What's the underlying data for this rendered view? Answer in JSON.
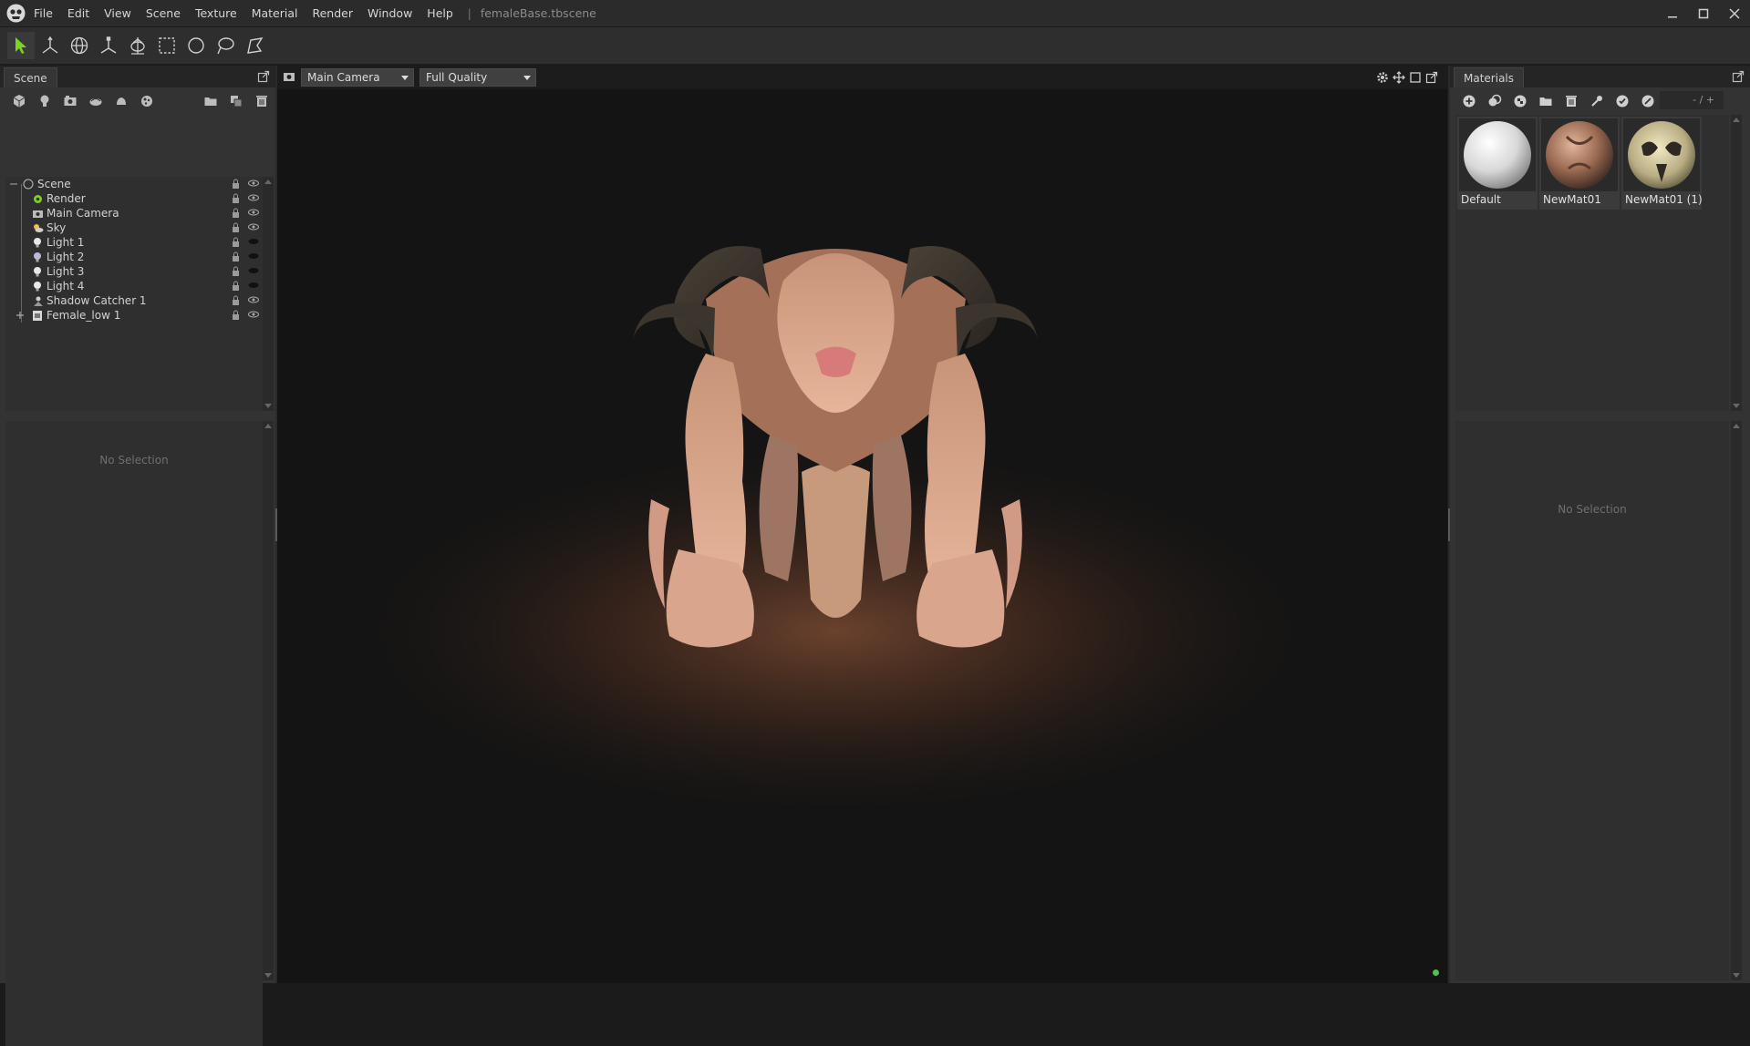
{
  "app": {
    "menu": [
      "File",
      "Edit",
      "View",
      "Scene",
      "Texture",
      "Material",
      "Render",
      "Window",
      "Help"
    ],
    "title_separator": "|",
    "file_title": "femaleBase.tbscene",
    "window_controls": [
      "minimize-icon",
      "maximize-icon",
      "close-icon"
    ]
  },
  "toolbar": {
    "tools": [
      "select-arrow-icon",
      "translate-gizmo-icon",
      "rotate-globe-icon",
      "scale-gizmo-icon",
      "pivot-icon",
      "rect-select-icon",
      "circle-select-icon",
      "lasso-select-icon",
      "polygon-select-icon"
    ],
    "active_color": "#7ed321"
  },
  "scene_panel": {
    "tab_label": "Scene",
    "icons": [
      "add-mesh-icon",
      "add-light-icon",
      "add-camera-icon",
      "add-sky-icon",
      "add-shadow-catcher-icon",
      "add-material-ball-icon",
      "open-folder-icon",
      "duplicate-icon",
      "delete-icon"
    ],
    "tree": [
      {
        "label": "Scene",
        "icon": "scene-root-icon",
        "level": 0
      },
      {
        "label": "Render",
        "icon": "render-gear-icon",
        "level": 1
      },
      {
        "label": "Main Camera",
        "icon": "camera-icon",
        "level": 1
      },
      {
        "label": "Sky",
        "icon": "sky-sun-icon",
        "level": 1
      },
      {
        "label": "Light 1",
        "icon": "bulb-icon",
        "level": 1
      },
      {
        "label": "Light 2",
        "icon": "bulb-icon",
        "level": 1
      },
      {
        "label": "Light 3",
        "icon": "bulb-icon",
        "level": 1
      },
      {
        "label": "Light 4",
        "icon": "bulb-icon",
        "level": 1
      },
      {
        "label": "Shadow Catcher 1",
        "icon": "shadow-catcher-icon",
        "level": 1
      },
      {
        "label": "Female_low 1",
        "icon": "mesh-object-icon",
        "level": 1
      }
    ],
    "properties_placeholder": "No Selection"
  },
  "viewport": {
    "camera_select": "Main Camera",
    "quality_select": "Full Quality",
    "right_icons": [
      "settings-gear-icon",
      "pan-move-icon",
      "fullscreen-frame-icon",
      "undock-icon"
    ],
    "status_color": "#4fc24f"
  },
  "materials_panel": {
    "tab_label": "Materials",
    "icons": [
      "add-material-icon",
      "duplicate-material-icon",
      "checker-icon",
      "open-folder-icon",
      "delete-icon",
      "assign-icon",
      "apply-icon",
      "reset-icon"
    ],
    "count_label": "- / +",
    "materials": [
      {
        "name": "Default",
        "thumb": "white-sphere"
      },
      {
        "name": "NewMat01",
        "thumb": "skin-sphere"
      },
      {
        "name": "NewMat01 (1)",
        "thumb": "bone-sphere"
      }
    ],
    "properties_placeholder": "No Selection"
  }
}
